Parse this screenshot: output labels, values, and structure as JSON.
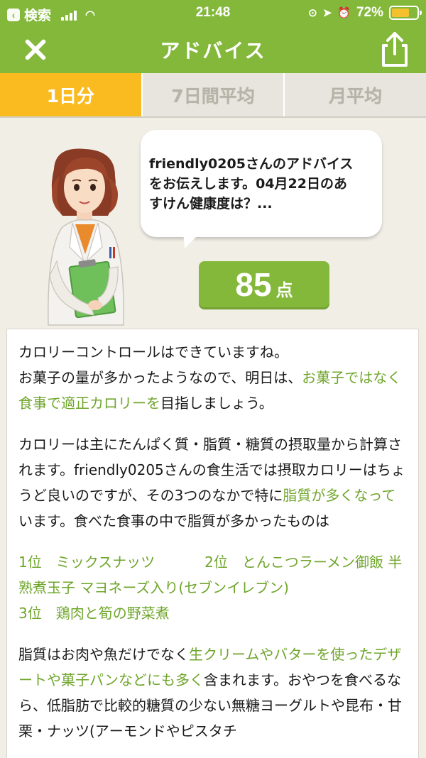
{
  "status_bar": {
    "back_label": "検索",
    "time": "21:48",
    "battery": "72%",
    "battery_level": 0.72
  },
  "nav": {
    "title": "アドバイス",
    "close_icon": "close-icon",
    "share_icon": "share-icon"
  },
  "tabs": [
    {
      "label": "1日分",
      "active": true
    },
    {
      "label": "7日間平均",
      "active": false
    },
    {
      "label": "月平均",
      "active": false
    }
  ],
  "bubble": {
    "line1": "friendly0205さんのアドバイス",
    "line2": "をお伝えします。04月22日のあ",
    "line3": "すけん健康度は？..."
  },
  "score": {
    "value": "85",
    "unit": "点"
  },
  "advice": {
    "p1": {
      "s1": "カロリーコントロールはできていますね。",
      "s2": "お菓子の量が多かったようなので、明日は、",
      "s3_green": "お菓子ではなく食事で適正カロリーを",
      "s4": "目指しましょう。"
    },
    "p2": {
      "s1": "カロリーは主にたんぱく質・脂質・糖質の摂取量から計算されます。friendly0205さんの食生活では摂取カロリーはちょうど良いのですが、その3つのなかで特に",
      "s2_green": "脂質が多くなって",
      "s3": "います。食べた食事の中で脂質が多かったものは"
    },
    "ranking": {
      "r1": "1位　ミックスナッツ",
      "r2": "2位　とんこつラーメン御飯 半熟煮玉子 マヨネーズ入り(セブンイレブン)",
      "r3": "3位　鶏肉と筍の野菜煮"
    },
    "p3": {
      "s1": "脂質はお肉や魚だけでなく",
      "s2_green": "生クリームやバターを使ったデザートや菓子パンなどにも多く",
      "s3": "含まれます。おやつを食べるなら、低脂肪で比較的糖質の少ない無糖ヨーグルトや昆布・甘栗・ナッツ(アーモンドやピスタチ"
    }
  },
  "colors": {
    "brand_green": "#84b83b",
    "accent_yellow": "#f9bb20",
    "highlight_green": "#6fa52b",
    "background": "#f1eee6"
  }
}
